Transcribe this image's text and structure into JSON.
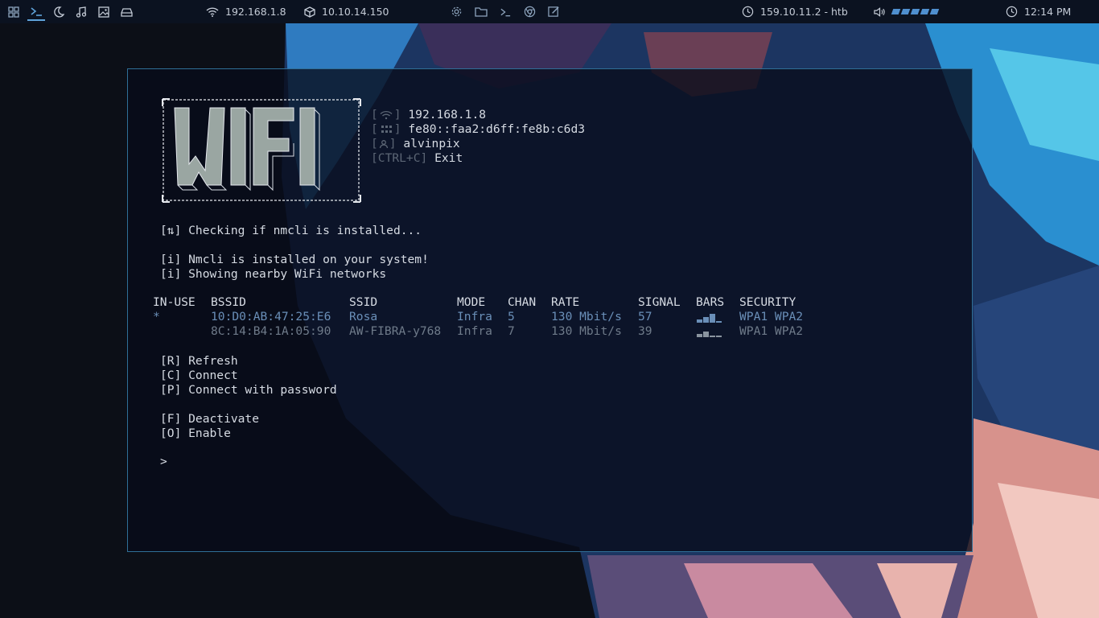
{
  "topbar": {
    "ip_wifi": "192.168.1.8",
    "ip_vpn": "10.10.14.150",
    "target": "159.10.11.2 - htb",
    "clock": "12:14 PM",
    "accent_color": "#4f8fcf"
  },
  "terminal": {
    "info": {
      "ip": "192.168.1.8",
      "ipv6": "fe80::faa2:d6ff:fe8b:c6d3",
      "user": "alvinpix",
      "exit_key": "[CTRL+C]",
      "exit_label": "Exit"
    },
    "messages": {
      "checking": "[⇅] Checking if nmcli is installed...",
      "installed": "[i] Nmcli is installed on your system!",
      "showing": "[i] Showing nearby WiFi networks"
    },
    "table": {
      "headers": [
        "IN-USE",
        "BSSID",
        "SSID",
        "MODE",
        "CHAN",
        "RATE",
        "SIGNAL",
        "BARS",
        "SECURITY"
      ],
      "rows": [
        {
          "in_use": "*",
          "bssid": "10:D0:AB:47:25:E6",
          "ssid": "Rosa",
          "mode": "Infra",
          "chan": "5",
          "rate": "130 Mbit/s",
          "signal": "57",
          "bars": 3,
          "security": "WPA1 WPA2"
        },
        {
          "in_use": "",
          "bssid": "8C:14:B4:1A:05:90",
          "ssid": "AW-FIBRA-y768",
          "mode": "Infra",
          "chan": "7",
          "rate": "130 Mbit/s",
          "signal": "39",
          "bars": 2,
          "security": "WPA1 WPA2"
        }
      ]
    },
    "menu": {
      "refresh": "[R] Refresh",
      "connect": "[C] Connect",
      "connect_pw": "[P] Connect with password",
      "deactivate": "[F] Deactivate",
      "enable": "[O] Enable"
    },
    "prompt": ">"
  }
}
